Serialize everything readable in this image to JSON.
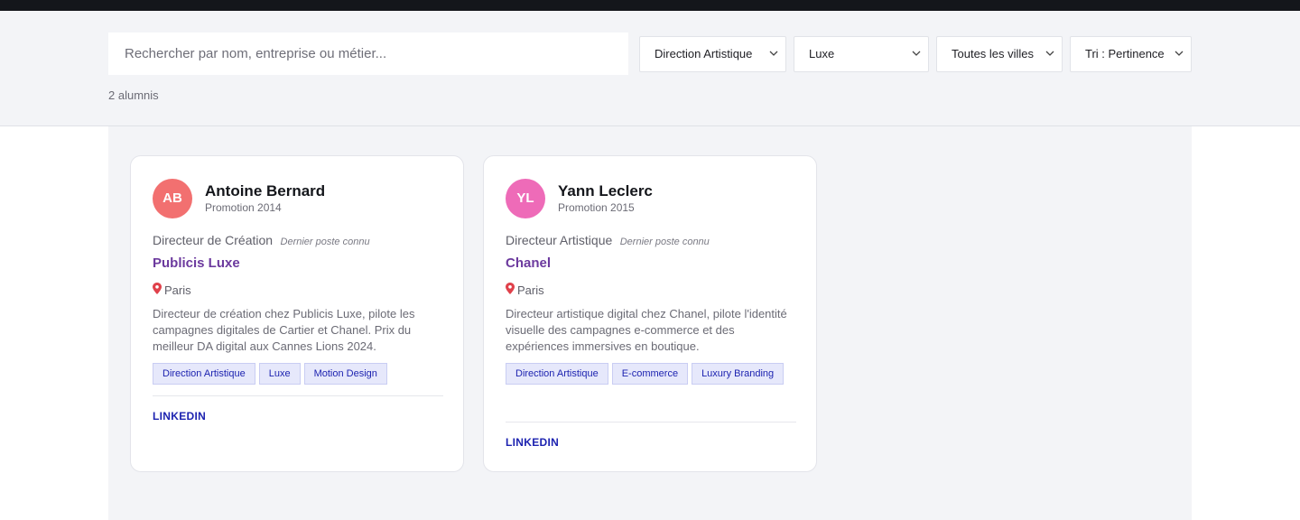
{
  "search": {
    "placeholder": "Rechercher par nom, entreprise ou métier..."
  },
  "filters": {
    "field": "Direction Artistique",
    "sector": "Luxe",
    "city": "Toutes les villes",
    "sort": "Tri : Pertinence"
  },
  "results_count": "2 alumnis",
  "icons": {
    "pin": "location-pin-icon",
    "chevron": "chevron-down-icon"
  },
  "colors": {
    "accent": "#1d23b0",
    "company": "#6c3a9e",
    "avatar_ab": "#f27070",
    "avatar_yl": "#ee6bb8"
  },
  "alumni": [
    {
      "initials": "AB",
      "name": "Antoine Bernard",
      "promotion": "Promotion 2014",
      "role": "Directeur de Création",
      "role_note": "Dernier poste connu",
      "company": "Publicis Luxe",
      "city": "Paris",
      "description": "Directeur de création chez Publicis Luxe, pilote les campagnes digitales de Cartier et Chanel. Prix du meilleur DA digital aux Cannes Lions 2024.",
      "tags": [
        "Direction Artistique",
        "Luxe",
        "Motion Design"
      ],
      "link_label": "LINKEDIN"
    },
    {
      "initials": "YL",
      "name": "Yann Leclerc",
      "promotion": "Promotion 2015",
      "role": "Directeur Artistique",
      "role_note": "Dernier poste connu",
      "company": "Chanel",
      "city": "Paris",
      "description": "Directeur artistique digital chez Chanel, pilote l'identité visuelle des campagnes e-commerce et des expériences immersives en boutique.",
      "tags": [
        "Direction Artistique",
        "E-commerce",
        "Luxury Branding"
      ],
      "link_label": "LINKEDIN"
    }
  ]
}
